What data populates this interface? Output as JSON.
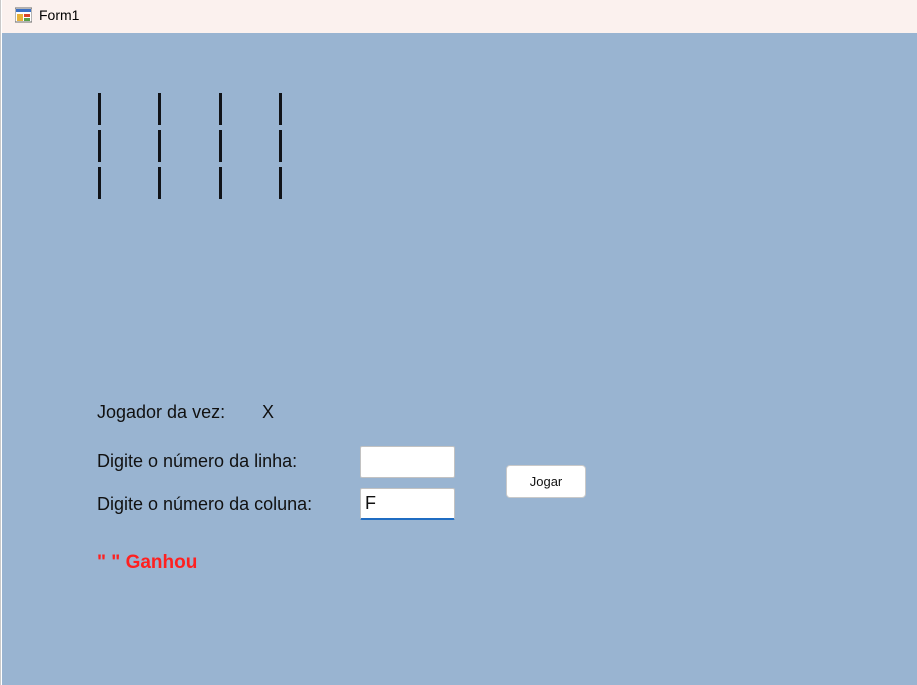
{
  "window": {
    "title": "Form1",
    "icon": "winforms-app-icon"
  },
  "board": {
    "rows": [
      [
        "|",
        "|",
        "|",
        "|"
      ],
      [
        "|",
        "|",
        "|",
        "|"
      ],
      [
        "|",
        "|",
        "|",
        "|"
      ]
    ]
  },
  "turn": {
    "label": "Jogador da vez:",
    "value": "X"
  },
  "row_input": {
    "label": "Digite o número da linha:",
    "value": ""
  },
  "column_input": {
    "label": "Digite o número da coluna:",
    "value": "F"
  },
  "play_button": {
    "label": "Jogar"
  },
  "winner_text": "\" \" Ganhou",
  "colors": {
    "client_background": "#99b4d1",
    "titlebar_background": "#fbf1ee",
    "winner": "#ff2020"
  }
}
